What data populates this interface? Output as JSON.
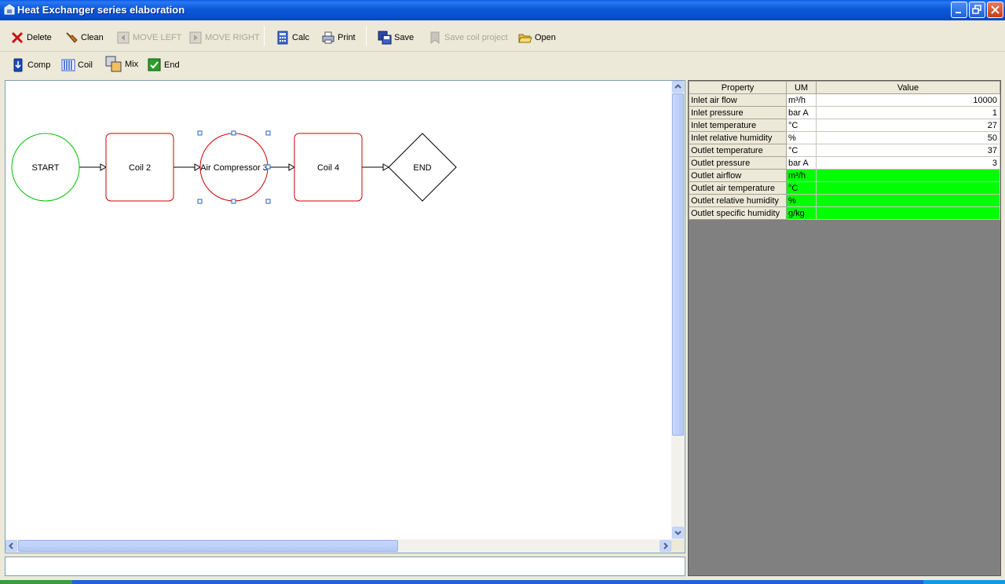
{
  "window": {
    "title": "Heat Exchanger series elaboration"
  },
  "toolbar1": {
    "delete": "Delete",
    "clean": "Clean",
    "move_left": "MOVE LEFT",
    "move_right": "MOVE RIGHT",
    "calc": "Calc",
    "print": "Print",
    "save": "Save",
    "save_coil_project": "Save coil project",
    "open": "Open"
  },
  "toolbar2": {
    "comp": "Comp",
    "coil": "Coil",
    "mix": "Mix",
    "end": "End"
  },
  "diagram": {
    "nodes": [
      "START",
      "Coil 2",
      "Air Compressor 3",
      "Coil 4",
      "END"
    ],
    "colors": {
      "start": "#00c000",
      "component": "#cc0000",
      "end": "#000000",
      "selection": "#2060c0"
    }
  },
  "properties": {
    "headers": [
      "Property",
      "UM",
      "Value"
    ],
    "rows": [
      {
        "property": "Inlet air flow",
        "um": "m³/h",
        "value": "10000"
      },
      {
        "property": "Inlet pressure",
        "um": "bar A",
        "value": "1"
      },
      {
        "property": "Inlet temperature",
        "um": "°C",
        "value": "27"
      },
      {
        "property": "Inlet relative humidity",
        "um": "%",
        "value": "50"
      },
      {
        "property": "Outlet temperature",
        "um": "°C",
        "value": "37"
      },
      {
        "property": "Outlet pressure",
        "um": "bar A",
        "value": "3"
      },
      {
        "property": "Outlet airflow",
        "um": "m³/h",
        "value": ""
      },
      {
        "property": "Outlet air temperature",
        "um": "°C",
        "value": ""
      },
      {
        "property": "Outlet relative humidity",
        "um": "%",
        "value": ""
      },
      {
        "property": "Outlet specific humidity",
        "um": "g/kg",
        "value": ""
      }
    ],
    "output_highlight_color": "#00ff00"
  }
}
